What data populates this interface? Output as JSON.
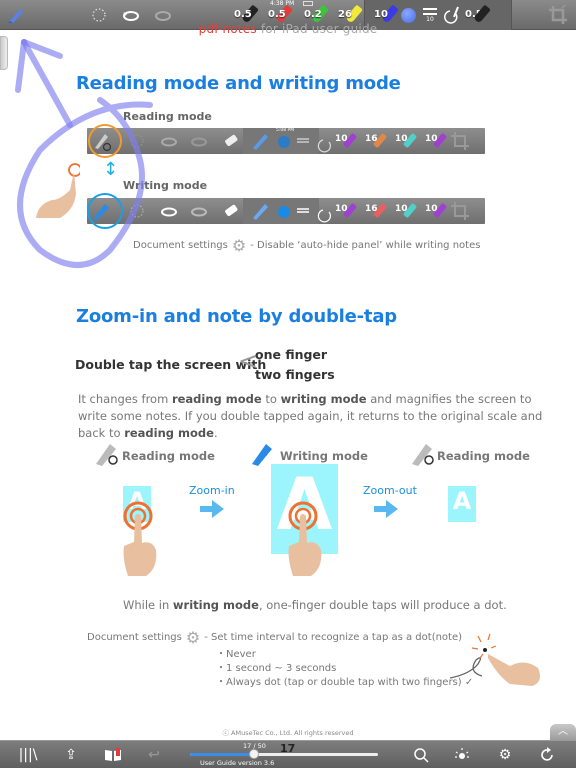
{
  "top_toolbar": {
    "status_time": "4:38 PM",
    "pens": [
      {
        "name": "pen-black",
        "size": "0.5",
        "color": "#222222"
      },
      {
        "name": "pen-red",
        "size": "0.5",
        "color": "#e33b3b"
      },
      {
        "name": "pen-green",
        "size": "0.2",
        "color": "#3cc43c"
      },
      {
        "name": "highlighter-yellow",
        "size": "26",
        "color": "#f2e93a"
      },
      {
        "name": "highlighter-blue",
        "size": "10",
        "color": "#3a3ae6"
      }
    ],
    "stroke_width_label": "10",
    "last_pen_size": "0.5",
    "accent_color": "#5a82e6"
  },
  "doc_header": {
    "brand": "pdf-notes",
    "rest": " for iPad user guide"
  },
  "section1": {
    "title": "Reading mode and writing mode",
    "reading_label": "Reading mode",
    "writing_label": "Writing mode",
    "mini_time": "5:08 PM",
    "mini_pens": [
      "10",
      "16",
      "10",
      "10"
    ],
    "settings_prefix": "Document settings",
    "settings_suffix": "- Disable ‘auto-hide panel’ while writing notes"
  },
  "section2": {
    "title": "Zoom-in and note by double-tap",
    "double_tap_prefix": "Double tap the screen with",
    "option_one": "one finger",
    "option_two": "two fingers",
    "para": [
      {
        "t": "It changes from ",
        "b": false
      },
      {
        "t": "reading mode",
        "b": true
      },
      {
        "t": " to ",
        "b": false
      },
      {
        "t": "writing mode",
        "b": true
      },
      {
        "t": " and magnifies the screen to write some notes. If you double tapped again, it returns to the original scale and back to ",
        "b": false
      },
      {
        "t": "reading mode",
        "b": true
      },
      {
        "t": ".",
        "b": false
      }
    ],
    "steps": [
      {
        "mode": "Reading mode"
      },
      {
        "mode": "Writing mode"
      },
      {
        "mode": "Reading mode"
      }
    ],
    "zoom_in": "Zoom-in",
    "zoom_out": "Zoom-out",
    "letter": "A",
    "dot_note_pre": "While in ",
    "dot_note_bold": "writing mode",
    "dot_note_post": ", one-finger double taps will produce a dot.",
    "settings_prefix": "Document settings",
    "settings_suffix": "- Set time interval to recognize a tap as a dot(note)",
    "options": [
      "・Never",
      "・1 second ~ 3 seconds",
      "・Always dot (tap or double tap with two fingers) ✓"
    ]
  },
  "footer": {
    "copyright": "ⓒ AMuseTec Co., Ltd. All rights reserved"
  },
  "bottom_toolbar": {
    "page_indicator": "17 / 50",
    "current_page": "17",
    "doc_version": "User Guide version 3.6",
    "progress_fraction": 0.34
  }
}
